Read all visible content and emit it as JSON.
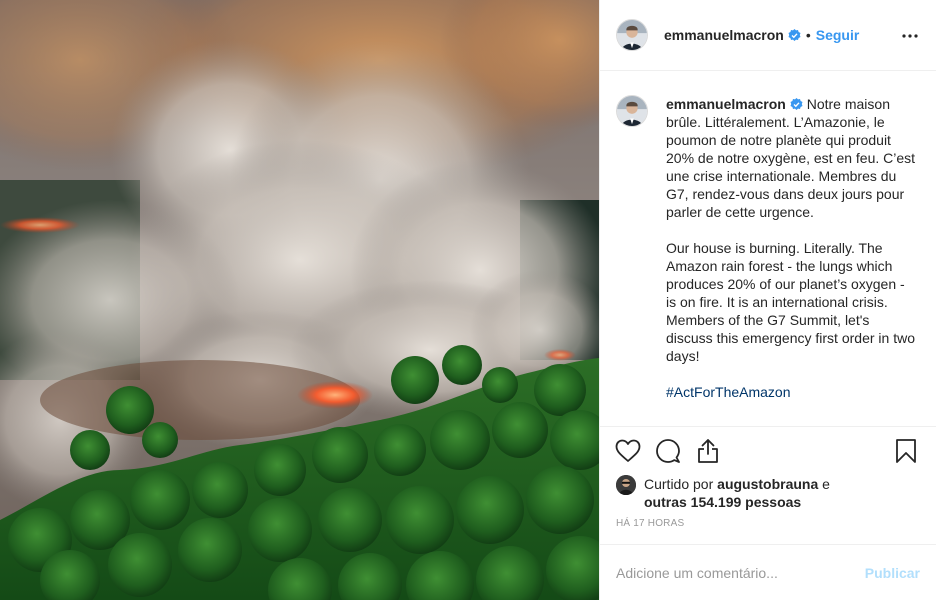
{
  "header": {
    "username": "emmanuelmacron",
    "dot": "•",
    "follow_label": "Seguir"
  },
  "caption": {
    "username": "emmanuelmacron",
    "text_fr": "Notre maison brûle. Littéralement. L’Amazonie, le poumon de notre planète qui produit 20% de notre oxygène, est en feu. C’est une crise internationale. Membres du G7, rendez-vous dans deux jours pour parler de cette urgence.",
    "text_en": "Our house is burning. Literally. The Amazon rain forest - the lungs which produces 20% of our planet’s oxygen - is on fire. It is an international crisis. Members of the G7 Summit, let's discuss this emergency first order in two days!",
    "hashtag": "#ActForTheAmazon"
  },
  "actions": {
    "icons": [
      "heart-icon",
      "comment-icon",
      "share-icon",
      "bookmark-icon"
    ]
  },
  "likes": {
    "prefix": "Curtido por",
    "user": "augustobrauna",
    "conj": "e",
    "others": "outras 154.199 pessoas"
  },
  "timestamp": "HÁ 17 HORAS",
  "add_comment": {
    "placeholder": "Adicione um comentário...",
    "publish_label": "Publicar"
  },
  "colors": {
    "link_blue": "#3897f0",
    "hashtag_blue": "#003569",
    "publish_disabled": "#b2dffc",
    "text": "#262626",
    "muted": "#999999",
    "border": "#efefef"
  }
}
